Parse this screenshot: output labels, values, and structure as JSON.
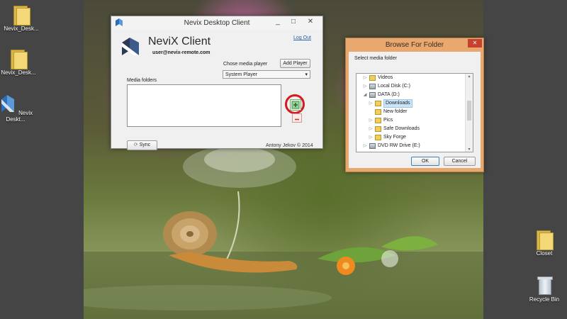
{
  "desktop": {
    "icons_left": [
      {
        "label": "Nevix_Desk...",
        "icon": "folder-icon"
      },
      {
        "label": "Nevix_Desk...",
        "icon": "folder-icon"
      },
      {
        "label": "Nevix Deskt...",
        "icon": "nevix-app-icon"
      }
    ],
    "icons_right": [
      {
        "label": "Closet",
        "icon": "folder-icon"
      },
      {
        "label": "Recycle Bin",
        "icon": "recycle-bin-icon"
      }
    ]
  },
  "main_window": {
    "title": "Nevix Desktop Client",
    "brand": "NeviX Client",
    "email": "user@nevix-remote.com",
    "logout_label": "Log Out",
    "media_player_label": "Chose media player",
    "add_player_label": "Add Player",
    "selected_player": "System Player",
    "media_folders_label": "Media folders",
    "sync_label": "Sync",
    "copyright": "Antony Jekov © 2014",
    "title_buttons": [
      "_",
      "□",
      "✕"
    ]
  },
  "browse_window": {
    "title": "Browse For Folder",
    "prompt": "Select media folder",
    "tree": [
      {
        "label": "Videos",
        "icon": "folder-icon",
        "expand": "▷",
        "level": 1
      },
      {
        "label": "Local Disk (C:)",
        "icon": "disk-icon",
        "expand": "▷",
        "level": 1
      },
      {
        "label": "DATA (D:)",
        "icon": "disk-icon",
        "expand": "◢",
        "level": 1
      },
      {
        "label": "Downloads",
        "icon": "folder-icon",
        "expand": "▷",
        "level": 2,
        "selected": true
      },
      {
        "label": "New folder",
        "icon": "folder-icon",
        "expand": "",
        "level": 2
      },
      {
        "label": "Pics",
        "icon": "folder-icon",
        "expand": "▷",
        "level": 2
      },
      {
        "label": "Safe Downloads",
        "icon": "folder-icon",
        "expand": "▷",
        "level": 2
      },
      {
        "label": "Sky Forge",
        "icon": "folder-icon",
        "expand": "▷",
        "level": 2
      },
      {
        "label": "DVD RW Drive (E:)",
        "icon": "disk-icon",
        "expand": "▷",
        "level": 1
      }
    ],
    "ok_label": "OK",
    "cancel_label": "Cancel",
    "close_glyph": "✕"
  },
  "colors": {
    "accent_red": "#d41a1a",
    "close_red": "#c7412f",
    "browse_frame": "#e8a870",
    "link_blue": "#2b5fa8"
  }
}
